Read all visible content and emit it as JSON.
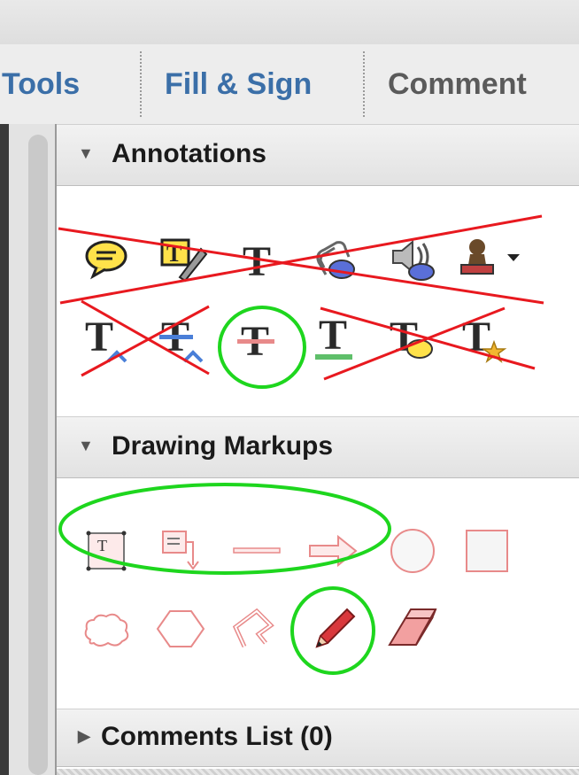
{
  "tabs": {
    "tools": "Tools",
    "fill_sign": "Fill & Sign",
    "comment": "Comment"
  },
  "colors": {
    "tab_text_blue": "#3b6fa8",
    "tab_text_gray": "#5a5a5a",
    "strike_red": "#e8191f",
    "highlight_green": "#1ed61e",
    "markup_pink": "#e88a8a"
  },
  "sections": {
    "annotations": {
      "title": "Annotations",
      "tools": [
        "sticky-note-icon",
        "text-callout-icon",
        "add-text-icon",
        "attach-file-icon",
        "record-audio-icon",
        "stamp-icon",
        "insert-text-icon",
        "replace-text-icon",
        "strikethrough-icon",
        "underline-icon",
        "text-note-icon",
        "add-note-to-text-icon"
      ]
    },
    "drawing_markups": {
      "title": "Drawing Markups",
      "tools": [
        "text-box-icon",
        "callout-icon",
        "line-icon",
        "arrow-icon",
        "oval-icon",
        "rectangle-icon",
        "cloud-icon",
        "polygon-icon",
        "polyline-icon",
        "pencil-icon",
        "eraser-icon"
      ]
    },
    "comments_list": {
      "title": "Comments List (0)"
    }
  }
}
